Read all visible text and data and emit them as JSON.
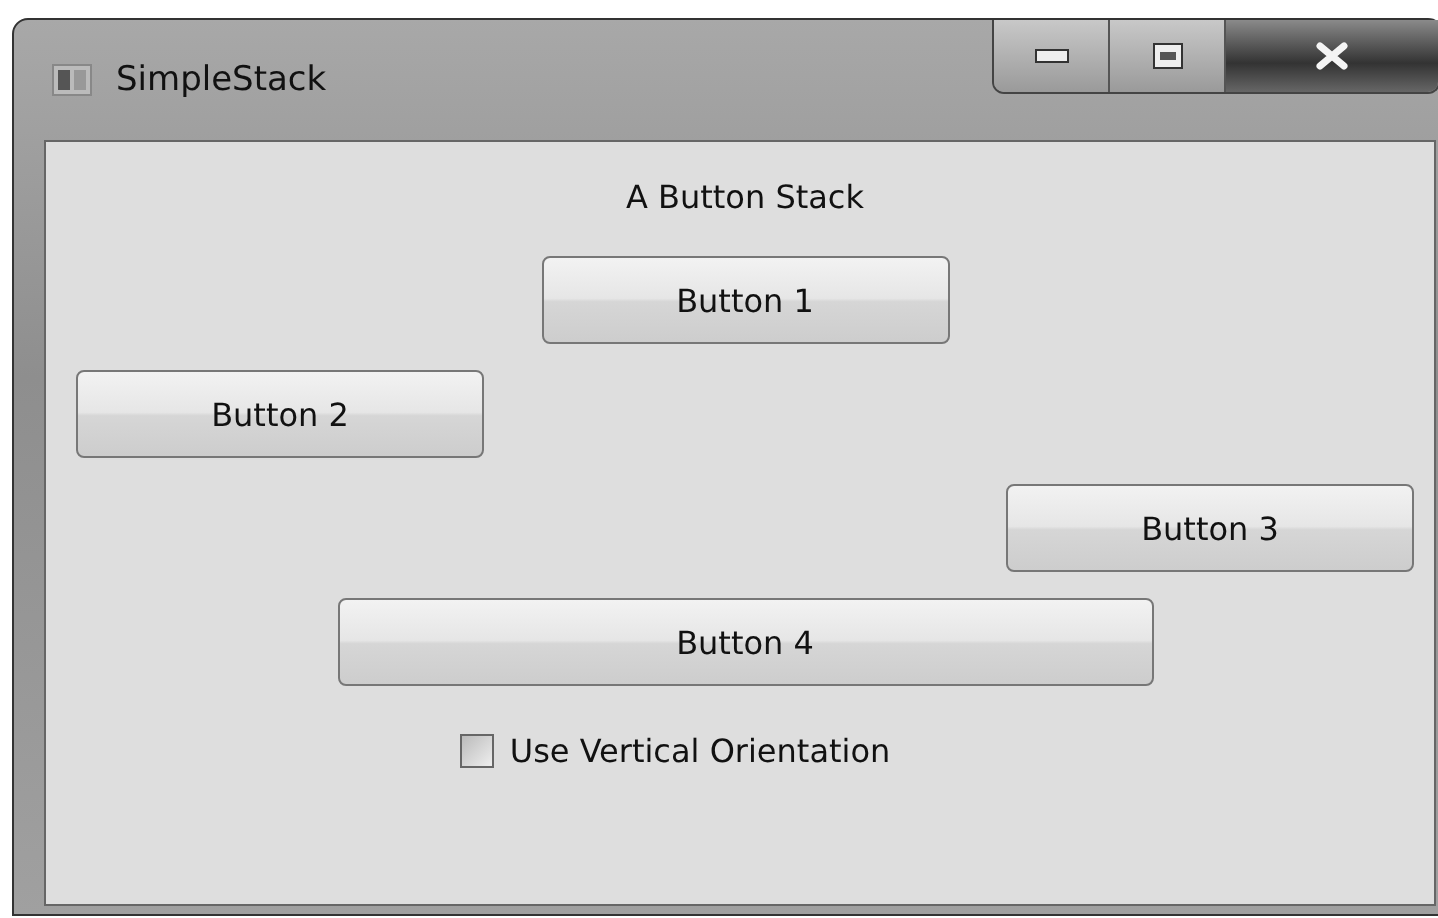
{
  "window": {
    "title": "SimpleStack"
  },
  "heading": "A Button Stack",
  "buttons": [
    {
      "label": "Button 1",
      "kind": "centered"
    },
    {
      "label": "Button 2",
      "kind": "left"
    },
    {
      "label": "Button 3",
      "kind": "right"
    },
    {
      "label": "Button 4",
      "kind": "wide"
    }
  ],
  "checkbox": {
    "label": "Use Vertical Orientation",
    "checked": false
  }
}
